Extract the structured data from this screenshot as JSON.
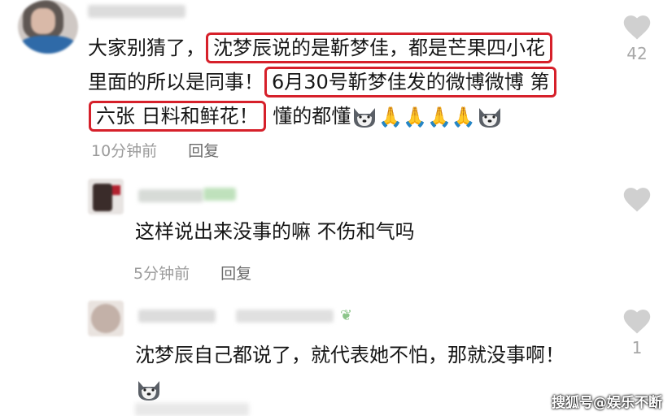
{
  "comments": [
    {
      "line1_plain": "大家别猜了，",
      "line1_highlight": "沈梦辰说的是靳梦佳，都是芒果四小花",
      "line2_plain": "里面的所以是同事！",
      "line2_highlight": "6月30号靳梦佳发的微博微博 第",
      "line3_highlight": "六张 日料和鲜花！",
      "line3_plain": "懂的都懂",
      "emojis": "🙏🙏🙏🙏",
      "time": "10分钟前",
      "reply_label": "回复",
      "like_count": "42"
    },
    {
      "text": "这样说出来没事的嘛 不伤和气吗",
      "time": "5分钟前",
      "reply_label": "回复",
      "like_count": ""
    },
    {
      "text": "沈梦辰自己都说了，就代表她不怕，那就没事啊！",
      "like_count": "1"
    }
  ],
  "watermark": "搜狐号@娱乐不断",
  "icons": {
    "like": "heart-icon",
    "emoji_dog": "doge-emoji-icon",
    "emoji_pray": "folded-hands-icon"
  },
  "colors": {
    "highlight_border": "#d6202a",
    "meta_text": "#9b9b9b",
    "heart": "#d0d0d0"
  }
}
